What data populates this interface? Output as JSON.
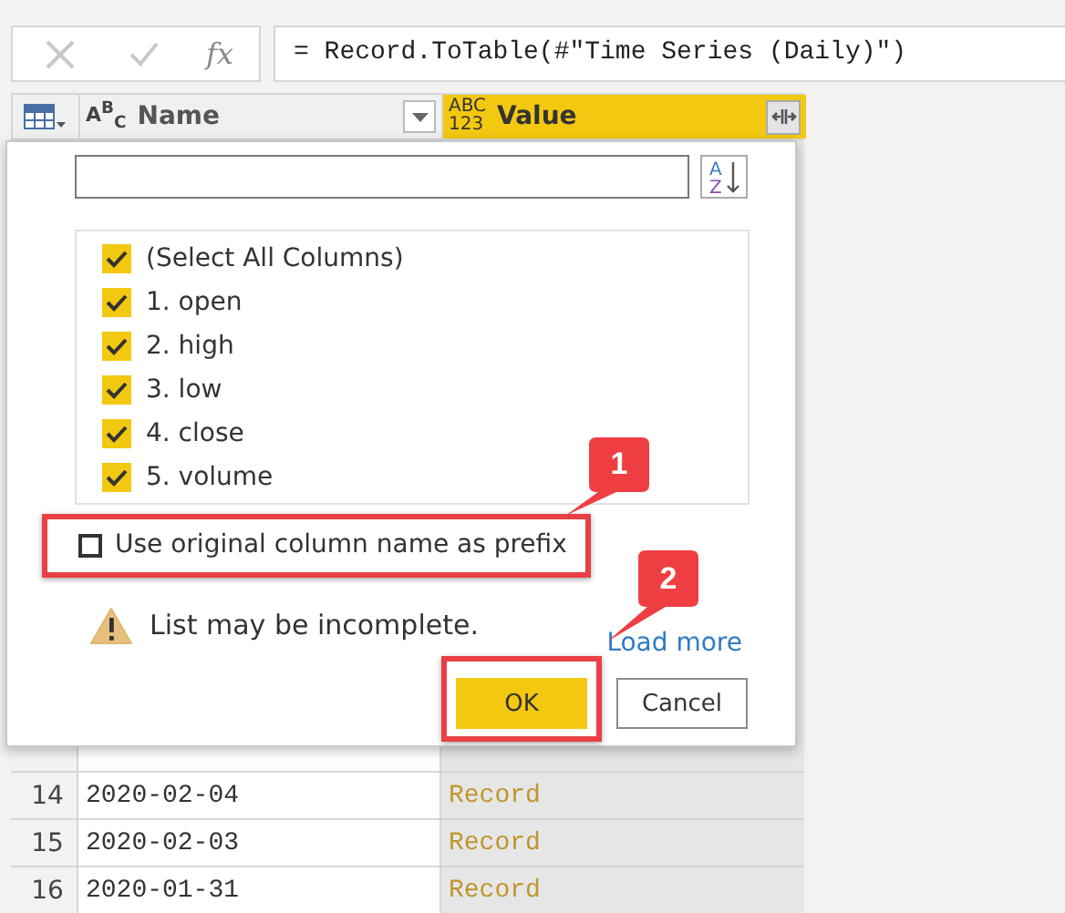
{
  "formula_bar": {
    "fx": "fx",
    "formula": "= Record.ToTable(#\"Time Series (Daily)\")"
  },
  "table": {
    "columns": [
      {
        "name": "Name",
        "type_label": [
          "A$^{B}$$_{C}$"
        ],
        "selected": false
      },
      {
        "name": "Value",
        "type_label": [
          "ABC",
          "123"
        ],
        "selected": true
      }
    ],
    "rows": [
      {
        "index": "14",
        "name": "2020-02-04",
        "value": "Record"
      },
      {
        "index": "15",
        "name": "2020-02-03",
        "value": "Record"
      },
      {
        "index": "16",
        "name": "2020-01-31",
        "value": "Record"
      }
    ]
  },
  "dialog": {
    "sort_letters": [
      "A",
      "Z"
    ],
    "items": [
      {
        "label": "(Select All Columns)",
        "checked": true
      },
      {
        "label": "1. open",
        "checked": true
      },
      {
        "label": "2. high",
        "checked": true
      },
      {
        "label": "3. low",
        "checked": true
      },
      {
        "label": "4. close",
        "checked": true
      },
      {
        "label": "5. volume",
        "checked": true
      }
    ],
    "prefix": {
      "label": "Use original column name as prefix",
      "checked": false
    },
    "warning": "List may be incomplete.",
    "link": "Load more",
    "buttons": [
      {
        "label": "OK",
        "kind": "primary"
      },
      {
        "label": "Cancel",
        "kind": "secondary"
      }
    ]
  },
  "callouts": [
    {
      "label": "1"
    },
    {
      "label": "2"
    }
  ]
}
